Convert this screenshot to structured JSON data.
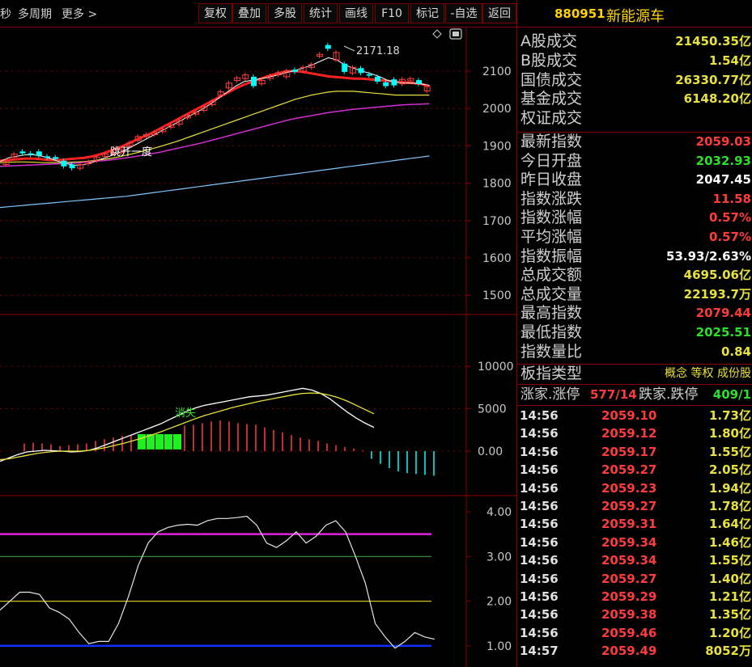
{
  "toolbar": {
    "left_items": [
      "秒",
      "多周期",
      "更多"
    ],
    "more_arrow": ">",
    "buttons": [
      "复权",
      "叠加",
      "多股",
      "统计",
      "画线",
      "F10",
      "标记",
      "-自选",
      "返回"
    ]
  },
  "colors": {
    "up": "#ff3c3c",
    "down": "#00ffff",
    "ma5": "#ffffff",
    "ma10": "#ff2020",
    "ma20": "#e8e23c",
    "ma60": "#d030d0",
    "ma120": "#80c8ff",
    "grid": "#7a0000"
  },
  "main_chart": {
    "y_ticks": [
      "2100",
      "2000",
      "1900",
      "1800",
      "1700",
      "1600",
      "1500"
    ],
    "peak_label": "2171.18",
    "annotation_text": "跳开一度",
    "icons": [
      "diamond-icon",
      "window-icon"
    ]
  },
  "macd_panel": {
    "y_ticks": [
      "10000",
      "5000",
      "0.00"
    ],
    "annotation_text": "消失"
  },
  "third_panel": {
    "y_ticks": [
      "4.00",
      "3.00",
      "2.00",
      "1.00"
    ]
  },
  "panel": {
    "code": "880951",
    "name": "新能源车",
    "summary_rows": [
      {
        "label": "A股成交",
        "value": "21450.35亿",
        "color": "yellow"
      },
      {
        "label": "B股成交",
        "value": "1.54亿",
        "color": "yellow"
      },
      {
        "label": "国债成交",
        "value": "26330.77亿",
        "color": "yellow"
      },
      {
        "label": "基金成交",
        "value": "6148.20亿",
        "color": "yellow"
      },
      {
        "label": "权证成交",
        "value": "",
        "color": "yellow"
      }
    ],
    "index_rows": [
      {
        "label": "最新指数",
        "value": "2059.03",
        "color": "red"
      },
      {
        "label": "今日开盘",
        "value": "2032.93",
        "color": "green"
      },
      {
        "label": "昨日收盘",
        "value": "2047.45",
        "color": "white"
      },
      {
        "label": "指数涨跌",
        "value": "11.58",
        "color": "red"
      },
      {
        "label": "指数涨幅",
        "value": "0.57%",
        "color": "red"
      },
      {
        "label": "平均涨幅",
        "value": "0.57%",
        "color": "red"
      },
      {
        "label": "指数振幅",
        "value": "53.93/2.63%",
        "color": "white"
      },
      {
        "label": "总成交额",
        "value": "4695.06亿",
        "color": "yellow"
      },
      {
        "label": "总成交量",
        "value": "22193.7万",
        "color": "yellow"
      },
      {
        "label": "最高指数",
        "value": "2079.44",
        "color": "red"
      },
      {
        "label": "最低指数",
        "value": "2025.51",
        "color": "green"
      },
      {
        "label": "指数量比",
        "value": "0.84",
        "color": "yellow"
      }
    ],
    "type_row": {
      "label": "板指类型",
      "value": "概念 等权 成份股",
      "value_parts": [
        "概念",
        "等权",
        "成份股"
      ]
    },
    "updown_row": {
      "up_label": "涨家.涨停",
      "up_value": "577/14",
      "down_label": "跌家.跌停",
      "down_value": "409/1"
    },
    "ticks": [
      {
        "time": "14:56",
        "price": "2059.10",
        "vol": "1.73亿"
      },
      {
        "time": "14:56",
        "price": "2059.12",
        "vol": "1.80亿"
      },
      {
        "time": "14:56",
        "price": "2059.17",
        "vol": "1.55亿"
      },
      {
        "time": "14:56",
        "price": "2059.27",
        "vol": "2.05亿"
      },
      {
        "time": "14:56",
        "price": "2059.23",
        "vol": "1.94亿"
      },
      {
        "time": "14:56",
        "price": "2059.27",
        "vol": "1.78亿"
      },
      {
        "time": "14:56",
        "price": "2059.31",
        "vol": "1.64亿"
      },
      {
        "time": "14:56",
        "price": "2059.34",
        "vol": "1.46亿"
      },
      {
        "time": "14:56",
        "price": "2059.34",
        "vol": "1.55亿"
      },
      {
        "time": "14:56",
        "price": "2059.27",
        "vol": "1.40亿"
      },
      {
        "time": "14:56",
        "price": "2059.29",
        "vol": "1.21亿"
      },
      {
        "time": "14:56",
        "price": "2059.38",
        "vol": "1.35亿"
      },
      {
        "time": "14:56",
        "price": "2059.46",
        "vol": "1.20亿"
      },
      {
        "time": "14:57",
        "price": "2059.49",
        "vol": "8052万"
      }
    ]
  }
}
